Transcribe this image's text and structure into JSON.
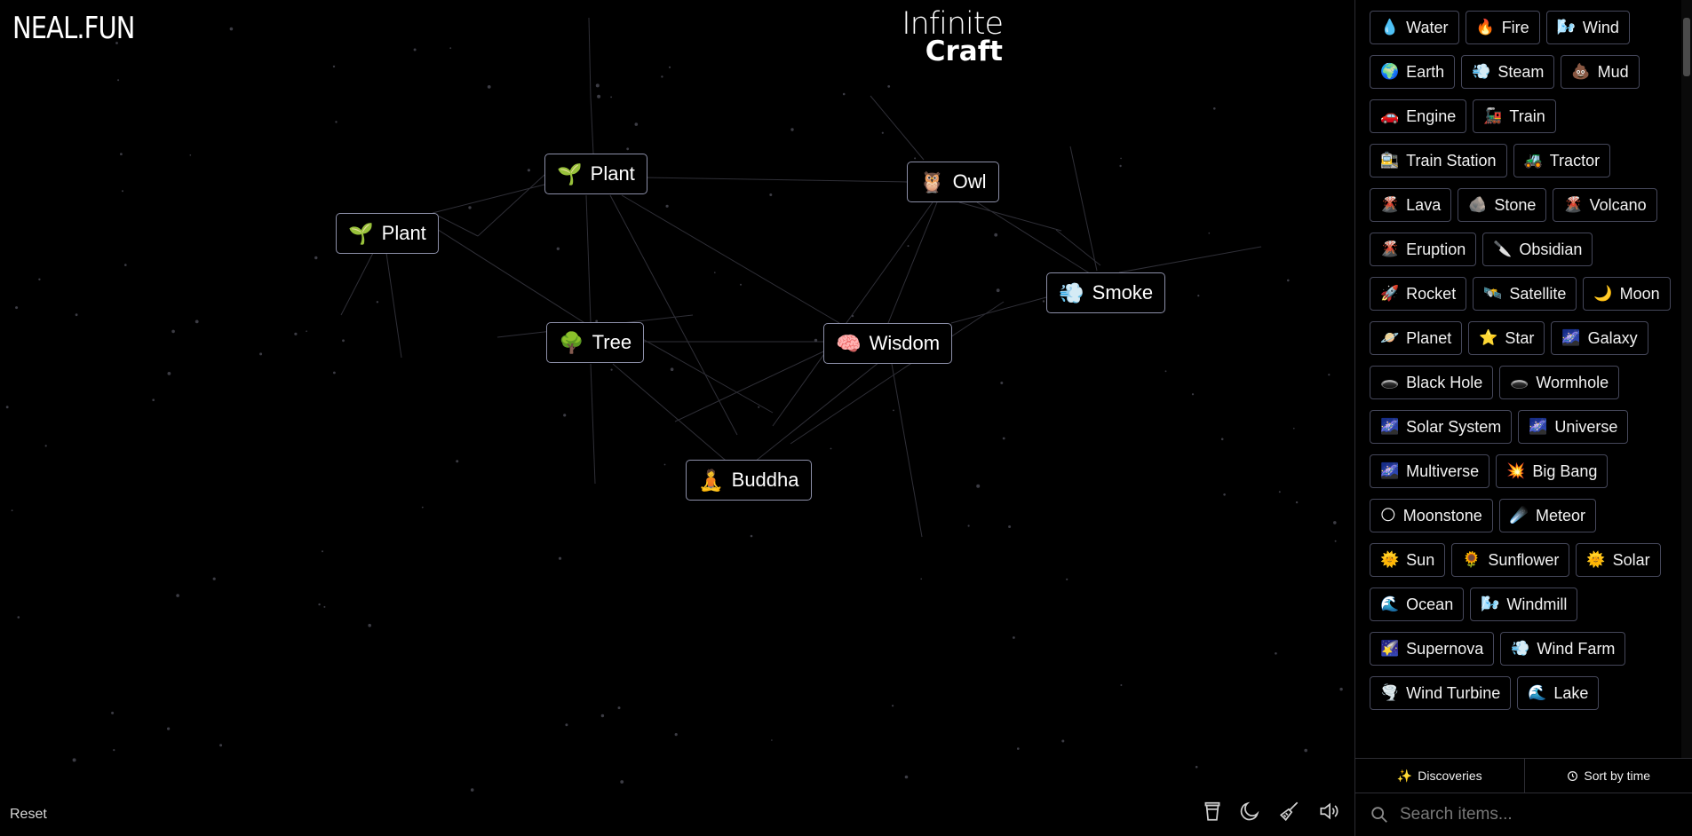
{
  "header": {
    "logo": "NEAL.FUN",
    "title_line1": "Infinite",
    "title_line2": "Craft"
  },
  "canvas": {
    "nodes": [
      {
        "id": "plant-1",
        "emoji": "🌱",
        "label": "Plant"
      },
      {
        "id": "plant-2",
        "emoji": "🌱",
        "label": "Plant"
      },
      {
        "id": "owl",
        "emoji": "🦉",
        "label": "Owl"
      },
      {
        "id": "smoke",
        "emoji": "💨",
        "label": "Smoke"
      },
      {
        "id": "tree",
        "emoji": "🌳",
        "label": "Tree"
      },
      {
        "id": "wisdom",
        "emoji": "🧠",
        "label": "Wisdom"
      },
      {
        "id": "buddha",
        "emoji": "🧘",
        "label": "Buddha"
      }
    ]
  },
  "footer": {
    "reset_label": "Reset",
    "tools": [
      "coffee-cup-icon",
      "moon-icon",
      "broom-icon",
      "speaker-icon"
    ]
  },
  "sidebar": {
    "items": [
      {
        "emoji": "💧",
        "label": "Water"
      },
      {
        "emoji": "🔥",
        "label": "Fire"
      },
      {
        "emoji": "🌬️",
        "label": "Wind"
      },
      {
        "emoji": "🌍",
        "label": "Earth"
      },
      {
        "emoji": "💨",
        "label": "Steam"
      },
      {
        "emoji": "💩",
        "label": "Mud"
      },
      {
        "emoji": "🚗",
        "label": "Engine"
      },
      {
        "emoji": "🚂",
        "label": "Train"
      },
      {
        "emoji": "🚉",
        "label": "Train Station"
      },
      {
        "emoji": "🚜",
        "label": "Tractor"
      },
      {
        "emoji": "🌋",
        "label": "Lava"
      },
      {
        "emoji": "🪨",
        "label": "Stone"
      },
      {
        "emoji": "🌋",
        "label": "Volcano"
      },
      {
        "emoji": "🌋",
        "label": "Eruption"
      },
      {
        "emoji": "🔪",
        "label": "Obsidian"
      },
      {
        "emoji": "🚀",
        "label": "Rocket"
      },
      {
        "emoji": "🛰️",
        "label": "Satellite"
      },
      {
        "emoji": "🌙",
        "label": "Moon"
      },
      {
        "emoji": "🪐",
        "label": "Planet"
      },
      {
        "emoji": "⭐",
        "label": "Star"
      },
      {
        "emoji": "🌌",
        "label": "Galaxy"
      },
      {
        "emoji": "🕳️",
        "label": "Black Hole"
      },
      {
        "emoji": "🕳️",
        "label": "Wormhole"
      },
      {
        "emoji": "🌌",
        "label": "Solar System"
      },
      {
        "emoji": "🌌",
        "label": "Universe"
      },
      {
        "emoji": "🌌",
        "label": "Multiverse"
      },
      {
        "emoji": "💥",
        "label": "Big Bang"
      },
      {
        "emoji": "🌕",
        "label": "Moonstone"
      },
      {
        "emoji": "☄️",
        "label": "Meteor"
      },
      {
        "emoji": "🌞",
        "label": "Sun"
      },
      {
        "emoji": "🌻",
        "label": "Sunflower"
      },
      {
        "emoji": "🌞",
        "label": "Solar"
      },
      {
        "emoji": "🌊",
        "label": "Ocean"
      },
      {
        "emoji": "🌬️",
        "label": "Windmill"
      },
      {
        "emoji": "🌠",
        "label": "Supernova"
      },
      {
        "emoji": "💨",
        "label": "Wind Farm"
      },
      {
        "emoji": "🌪️",
        "label": "Wind Turbine"
      },
      {
        "emoji": "🌊",
        "label": "Lake"
      }
    ],
    "discoveries_label": "Discoveries",
    "sort_label": "Sort by time",
    "search_placeholder": "Search items..."
  }
}
